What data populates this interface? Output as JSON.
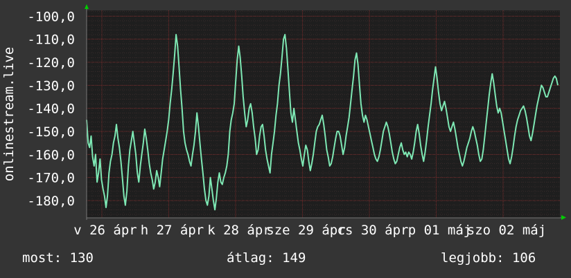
{
  "chart_data": {
    "type": "line",
    "title": "",
    "ylabel": "onlinestream.live",
    "xlabel": "",
    "ylim": [
      -187.5,
      -97.5
    ],
    "yticks": [
      -100,
      -110,
      -120,
      -130,
      -140,
      -150,
      -160,
      -170,
      -180
    ],
    "ytick_labels": [
      "-100,0",
      "-110,0",
      "-120,0",
      "-130,0",
      "-140,0",
      "-150,0",
      "-160,0",
      "-170,0",
      "-180,0"
    ],
    "x_axis_labels": [
      "v 26 ápr",
      "h 27 ápr",
      "k 28 ápr",
      "sze 29 ápr",
      "cs 30 ápr",
      "p 01 máj",
      "szo 02 máj"
    ],
    "grid": true,
    "colors": {
      "background": "#343434",
      "plot_background": "#1e1e1e",
      "line": "#7ee8b4",
      "grid": "#7a2a2a",
      "axis_arrow": "#00cc00"
    },
    "series": [
      {
        "values": [
          -145,
          -155,
          -157,
          -152,
          -161,
          -165,
          -160,
          -172,
          -168,
          -162,
          -171,
          -175,
          -178,
          -183,
          -178,
          -168,
          -163,
          -160,
          -155,
          -152,
          -147,
          -153,
          -157,
          -163,
          -170,
          -178,
          -182,
          -176,
          -165,
          -158,
          -154,
          -150,
          -155,
          -160,
          -168,
          -172,
          -165,
          -160,
          -155,
          -149,
          -153,
          -158,
          -164,
          -168,
          -171,
          -175,
          -172,
          -167,
          -170,
          -174,
          -168,
          -162,
          -158,
          -154,
          -150,
          -145,
          -138,
          -132,
          -125,
          -117,
          -108,
          -113,
          -122,
          -132,
          -140,
          -150,
          -155,
          -158,
          -160,
          -163,
          -165,
          -160,
          -156,
          -150,
          -142,
          -148,
          -155,
          -162,
          -168,
          -175,
          -180,
          -182,
          -178,
          -170,
          -175,
          -180,
          -184,
          -179,
          -172,
          -168,
          -172,
          -173,
          -170,
          -168,
          -165,
          -160,
          -150,
          -145,
          -142,
          -138,
          -128,
          -119,
          -113,
          -118,
          -126,
          -135,
          -142,
          -148,
          -145,
          -140,
          -138,
          -142,
          -148,
          -153,
          -160,
          -158,
          -152,
          -148,
          -147,
          -152,
          -158,
          -162,
          -165,
          -168,
          -160,
          -155,
          -150,
          -143,
          -138,
          -130,
          -125,
          -118,
          -110,
          -108,
          -114,
          -123,
          -133,
          -142,
          -146,
          -140,
          -145,
          -150,
          -155,
          -158,
          -162,
          -165,
          -160,
          -156,
          -158,
          -163,
          -167,
          -164,
          -160,
          -155,
          -150,
          -148,
          -147,
          -145,
          -143,
          -147,
          -152,
          -158,
          -161,
          -165,
          -164,
          -161,
          -157,
          -153,
          -150,
          -150,
          -152,
          -156,
          -160,
          -157,
          -152,
          -148,
          -144,
          -138,
          -132,
          -126,
          -119,
          -116,
          -121,
          -130,
          -138,
          -143,
          -146,
          -143,
          -145,
          -148,
          -151,
          -154,
          -157,
          -160,
          -162,
          -163,
          -161,
          -158,
          -154,
          -150,
          -148,
          -146,
          -148,
          -151,
          -155,
          -159,
          -162,
          -164,
          -163,
          -160,
          -157,
          -155,
          -158,
          -160,
          -159,
          -161,
          -159,
          -160,
          -162,
          -159,
          -155,
          -150,
          -147,
          -151,
          -156,
          -160,
          -163,
          -159,
          -154,
          -148,
          -143,
          -138,
          -132,
          -127,
          -122,
          -127,
          -133,
          -138,
          -141,
          -139,
          -137,
          -140,
          -144,
          -148,
          -150,
          -148,
          -146,
          -149,
          -153,
          -157,
          -160,
          -163,
          -165,
          -163,
          -160,
          -157,
          -155,
          -153,
          -150,
          -148,
          -150,
          -153,
          -156,
          -160,
          -163,
          -162,
          -158,
          -152,
          -146,
          -140,
          -134,
          -129,
          -125,
          -129,
          -134,
          -139,
          -142,
          -140,
          -142,
          -146,
          -150,
          -154,
          -158,
          -162,
          -164,
          -161,
          -157,
          -152,
          -148,
          -145,
          -143,
          -141,
          -140,
          -139,
          -141,
          -144,
          -148,
          -152,
          -154,
          -151,
          -147,
          -143,
          -139,
          -136,
          -133,
          -130,
          -131,
          -133,
          -135,
          -135,
          -133,
          -131,
          -129,
          -127,
          -126,
          -127,
          -130
        ],
        "color": "#7ee8b4"
      }
    ]
  },
  "stats": {
    "now": "most: 130",
    "avg": "átlag: 149",
    "best": "legjobb: 106"
  }
}
